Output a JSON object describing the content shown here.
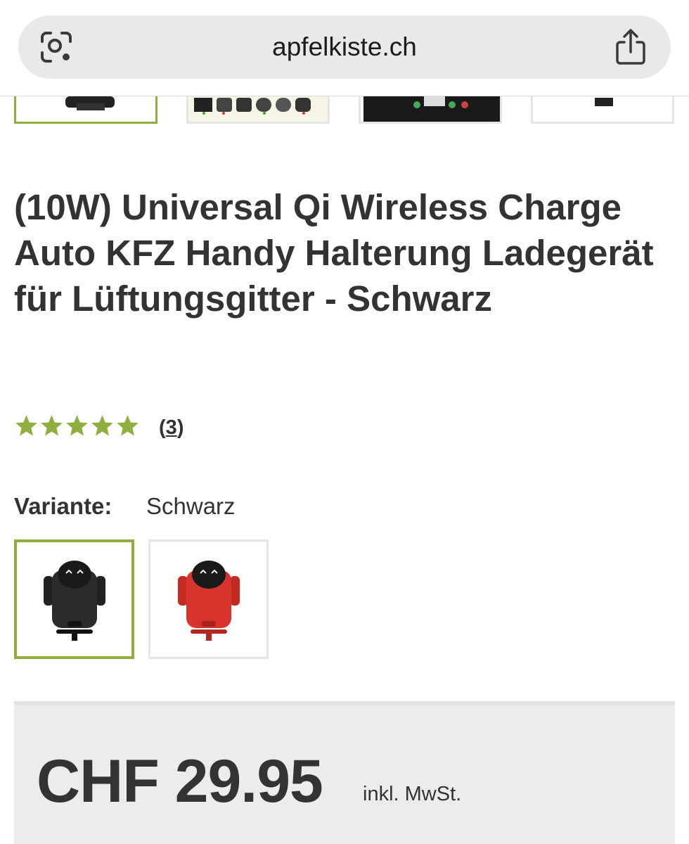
{
  "browser": {
    "url": "apfelkiste.ch",
    "scan_icon": "camera-scan-icon",
    "share_icon": "share-icon"
  },
  "gallery": {
    "thumbnails": [
      "thumbnail-1",
      "thumbnail-2",
      "thumbnail-3",
      "thumbnail-4"
    ]
  },
  "product": {
    "title": "(10W) Universal Qi Wireless Charge Auto KFZ Handy Halterung Ladegerät für Lüftungsgitter - Schwarz",
    "rating": {
      "stars": 5,
      "max": 5,
      "count_open": "(",
      "count": "3",
      "count_close": ")"
    },
    "variant": {
      "label": "Variante:",
      "value": "Schwarz",
      "options": [
        {
          "color_name": "black",
          "color": "#2b2b2b",
          "selected": true
        },
        {
          "color_name": "red",
          "color": "#d9342b",
          "selected": false
        }
      ]
    },
    "price": {
      "amount": "CHF 29.95",
      "tax_note": "inkl. MwSt."
    }
  },
  "colors": {
    "accent": "#8fae3e",
    "text": "#333333",
    "star": "#8fae3e"
  }
}
